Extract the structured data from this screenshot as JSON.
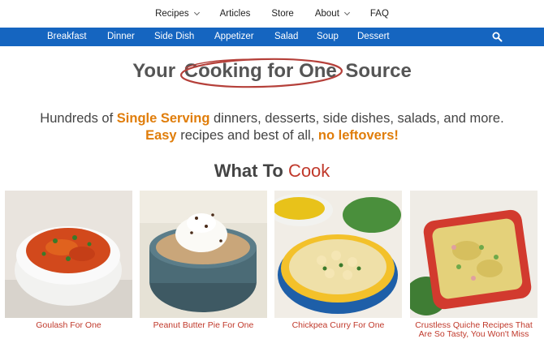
{
  "top_nav": [
    {
      "label": "Recipes",
      "has_dropdown": true
    },
    {
      "label": "Articles",
      "has_dropdown": false
    },
    {
      "label": "Store",
      "has_dropdown": false
    },
    {
      "label": "About",
      "has_dropdown": true
    },
    {
      "label": "FAQ",
      "has_dropdown": false
    }
  ],
  "categories": [
    "Breakfast",
    "Dinner",
    "Side Dish",
    "Appetizer",
    "Salad",
    "Soup",
    "Dessert"
  ],
  "icons": {
    "search": "search-icon",
    "dropdown": "chevron-down-icon"
  },
  "hero": {
    "before": "Your",
    "highlight": "Cooking for One",
    "after": "Source"
  },
  "tagline": {
    "line1_a": "Hundreds of",
    "line1_b": "Single Serving",
    "line1_c": "dinners, desserts, side dishes, salads, and more.",
    "line2_a": "Easy",
    "line2_b": "recipes and best of all,",
    "line2_c": "no leftovers!"
  },
  "section": {
    "before": "What To",
    "highlight": "Cook"
  },
  "cards": [
    {
      "title": "Goulash For One"
    },
    {
      "title": "Peanut Butter Pie For One"
    },
    {
      "title": "Chickpea Curry For One"
    },
    {
      "title": "Crustless Quiche Recipes That Are So Tasty, You Won't Miss"
    }
  ],
  "colors": {
    "nav_bar": "#1565c0",
    "accent_orange": "#e07d0a",
    "accent_red": "#c0392b"
  }
}
